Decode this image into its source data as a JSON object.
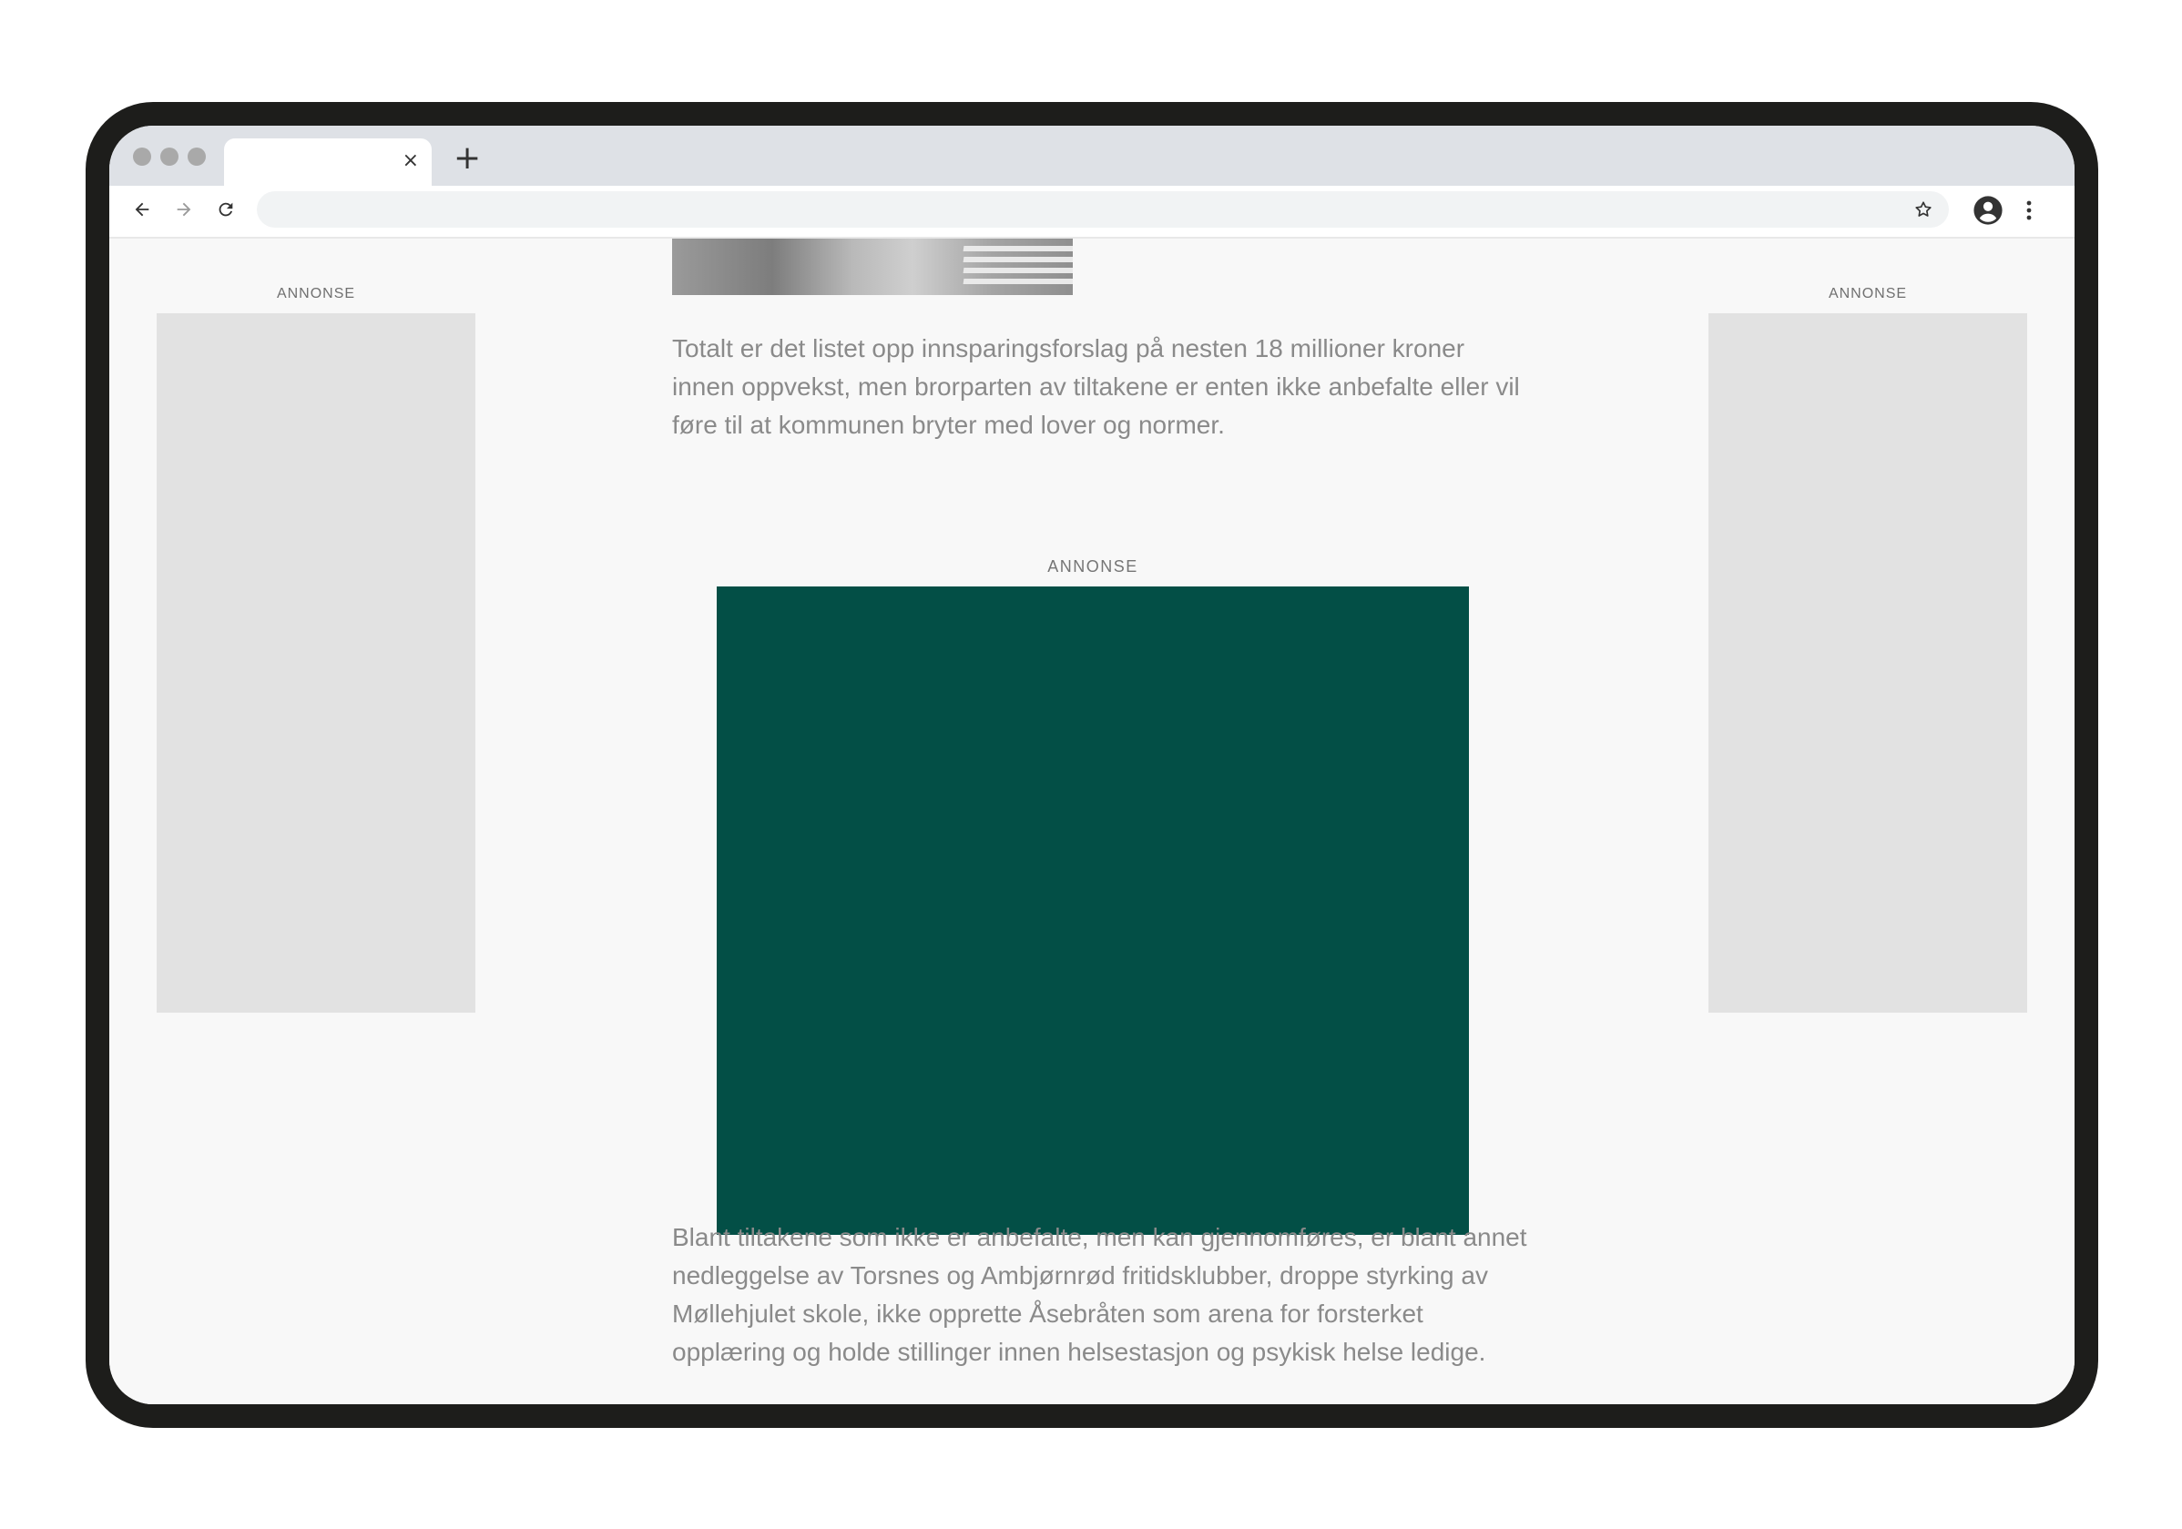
{
  "browser": {
    "tab_close_glyph": "×",
    "new_tab_glyph": "+",
    "address": ""
  },
  "ads": {
    "left_label": "ANNONSE",
    "right_label": "ANNONSE",
    "middle_label": "ANNONSE",
    "middle_color": "#034f46",
    "side_color": "#e2e2e2"
  },
  "article": {
    "paragraph_1": "Totalt er det listet opp innsparingsforslag på nesten 18 millioner kroner innen oppvekst, men brorparten av tiltakene er enten ikke anbefalte eller vil føre til at kommunen bryter med lover og normer.",
    "paragraph_2": "Blant tiltakene som ikke er anbefalte, men kan gjennomføres, er blant annet nedleggelse av Torsnes og Ambjørnrød fritidsklubber, droppe styrking av Møllehjulet skole, ikke opprette Åsebråten som arena for forsterket opplæring og holde stillinger innen helsestasjon og psykisk helse ledige."
  },
  "icons": {
    "back": "arrow-left-icon",
    "forward": "arrow-right-icon",
    "reload": "reload-icon",
    "bookmark": "star-icon",
    "profile": "account-circle-icon",
    "menu": "more-vertical-icon"
  }
}
